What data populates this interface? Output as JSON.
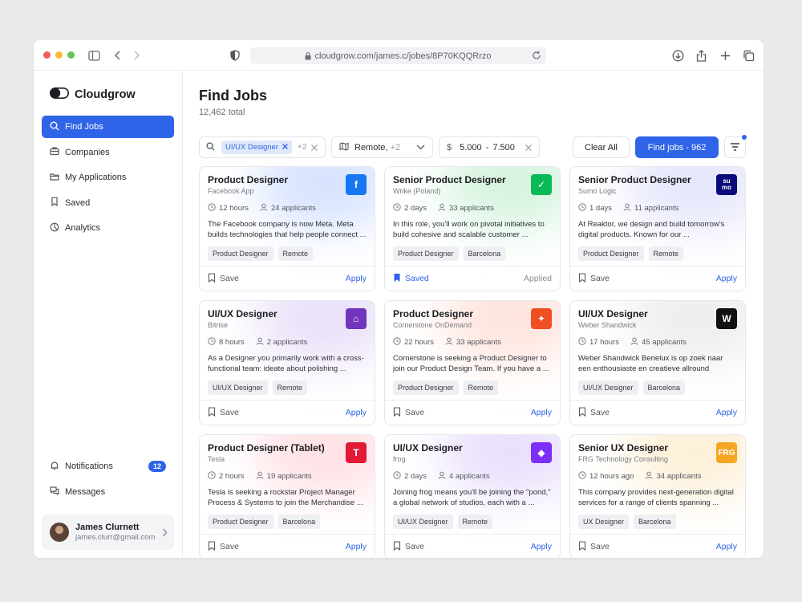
{
  "browser": {
    "url": "cloudgrow.com/james.c/jobes/8P70KQQRrzo",
    "colors": {
      "red": "#f0605b",
      "yellow": "#f6be3b",
      "green": "#62c554"
    }
  },
  "sidebar": {
    "brand": "Cloudgrow",
    "items": [
      {
        "label": "Find Jobs",
        "icon": "search-icon",
        "active": true
      },
      {
        "label": "Companies",
        "icon": "briefcase-icon"
      },
      {
        "label": "My Applications",
        "icon": "folder-icon"
      },
      {
        "label": "Saved",
        "icon": "bookmark-icon"
      },
      {
        "label": "Analytics",
        "icon": "pie-chart-icon"
      }
    ],
    "bottom": [
      {
        "label": "Notifications",
        "icon": "bell-icon",
        "badge": "12"
      },
      {
        "label": "Messages",
        "icon": "chat-icon"
      }
    ],
    "user": {
      "name": "James Clurnett",
      "email": "james.clurr@gmail.com"
    }
  },
  "main": {
    "title": "Find Jobs",
    "subtitle": "12,462 total",
    "filters": {
      "role_chip": "UI/UX Designer",
      "role_more": "+2",
      "location": "Remote,",
      "location_more": "+2",
      "salary_currency": "$",
      "salary_min": "5.000",
      "salary_sep": "-",
      "salary_max": "7.500"
    },
    "clear_label": "Clear All",
    "find_label": "Find jobs - 962"
  },
  "jobs": [
    {
      "title": "Product Designer",
      "company": "Facebook App",
      "time": "12 hours",
      "applicants": "24 applicants",
      "desc": "The Facebook company is now Meta. Meta builds technologies that help people connect ...",
      "tags": [
        "Product Designer",
        "Remote"
      ],
      "save": "Save",
      "apply": "Apply",
      "saved": false,
      "applied": false,
      "logo": "f",
      "logo_icon": "facebook-logo-icon",
      "logo_color": "#1877f2",
      "glow": "#8fb0ff"
    },
    {
      "title": "Senior Product Designer",
      "company": "Wrike (Poland)",
      "time": "2 days",
      "applicants": "33 applicants",
      "desc": "In this role, you'll work on pivotal initiatives to build cohesive and scalable customer ...",
      "tags": [
        "Product Designer",
        "Barcelona"
      ],
      "save": "Saved",
      "apply": "Applied",
      "saved": true,
      "applied": true,
      "logo": "✓",
      "logo_icon": "wrike-logo-icon",
      "logo_color": "#08b955",
      "glow": "#8de0a8"
    },
    {
      "title": "Senior Product Designer",
      "company": "Sumo Logic",
      "time": "1 days",
      "applicants": "11 applicants",
      "desc": "At Reaktor, we design and build tomorrow's digital products. Known for our ...",
      "tags": [
        "Product Designer",
        "Remote"
      ],
      "save": "Save",
      "apply": "Apply",
      "saved": false,
      "applied": false,
      "logo": "su mo",
      "logo_icon": "sumo-logo-icon",
      "logo_color": "#0a0a7a",
      "glow": "#b7b9f5"
    },
    {
      "title": "UI/UX Designer",
      "company": "Bitrise",
      "time": "8 hours",
      "applicants": "2 applicants",
      "desc": "As a Designer you primarily work with a cross-functional team: ideate about polishing ...",
      "tags": [
        "UI/UX Designer",
        "Remote"
      ],
      "save": "Save",
      "apply": "Apply",
      "saved": false,
      "applied": false,
      "logo": "⌂",
      "logo_icon": "bitrise-logo-icon",
      "logo_color": "#6f35bd",
      "glow": "#c4a8ef"
    },
    {
      "title": "Product Designer",
      "company": "Cornerstone OnDemand",
      "time": "22 hours",
      "applicants": "33 applicants",
      "desc": "Cornerstone is seeking a Product Designer to join our Product Design Team. If you have a ...",
      "tags": [
        "Product Designer",
        "Remote"
      ],
      "save": "Save",
      "apply": "Apply",
      "saved": false,
      "applied": false,
      "logo": "✦",
      "logo_icon": "cornerstone-logo-icon",
      "logo_color": "#f04e23",
      "glow": "#ffb3a1"
    },
    {
      "title": "UI/UX Designer",
      "company": "Weber Shandwick",
      "time": "17 hours",
      "applicants": "45 applicants",
      "desc": "Weber Shandwick Benelux is op zoek naar een enthousiaste en creatieve allround Designer ...",
      "tags": [
        "UI/UX Designer",
        "Barcelona"
      ],
      "save": "Save",
      "apply": "Apply",
      "saved": false,
      "applied": false,
      "logo": "W",
      "logo_icon": "weber-logo-icon",
      "logo_color": "#111111",
      "glow": "#cfcfd4"
    },
    {
      "title": "Product Designer (Tablet)",
      "company": "Tesla",
      "time": "2 hours",
      "applicants": "19 applicants",
      "desc": "Tesla is seeking a rockstar Project Manager Process & Systems to join the Merchandise ...",
      "tags": [
        "Product Designer",
        "Barcelona"
      ],
      "save": "Save",
      "apply": "Apply",
      "saved": false,
      "applied": false,
      "logo": "T",
      "logo_icon": "tesla-logo-icon",
      "logo_color": "#e31937",
      "glow": "#ffaab5"
    },
    {
      "title": "UI/UX Designer",
      "company": "frog",
      "time": "2 days",
      "applicants": "4 applicants",
      "desc": "Joining frog means you'll be joining the \"pond,\" a global network of studios, each with a ...",
      "tags": [
        "UI/UX Designer",
        "Remote"
      ],
      "save": "Save",
      "apply": "Apply",
      "saved": false,
      "applied": false,
      "logo": "◆",
      "logo_icon": "frog-logo-icon",
      "logo_color": "#7b2ff7",
      "glow": "#c2a5f7"
    },
    {
      "title": "Senior UX Designer",
      "company": "FRG Technology Consulting",
      "time": "12 hours ago",
      "applicants": "34 applicants",
      "desc": "This company provides next-generation digital services for a range of clients spanning ...",
      "tags": [
        "UX Designer",
        "Barcelona"
      ],
      "save": "Save",
      "apply": "Apply",
      "saved": false,
      "applied": false,
      "logo": "FRG",
      "logo_icon": "frg-logo-icon",
      "logo_color": "#f5a623",
      "glow": "#f8d48f"
    }
  ]
}
